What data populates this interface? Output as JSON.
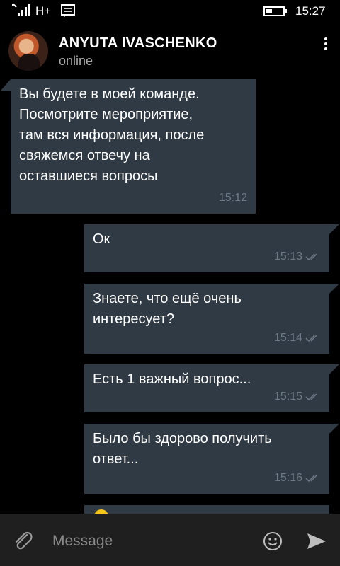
{
  "status_bar": {
    "network": "H+",
    "time": "15:27"
  },
  "header": {
    "name": "ANYUTA IVASCHENKO",
    "status": "online"
  },
  "messages": [
    {
      "dir": "in",
      "text": "Вы будете в моей команде.\nПосмотрите мероприятие,\nтам вся информация, после\nсвяжемся отвечу на\nоставшиеся вопросы",
      "time": "15:12"
    },
    {
      "dir": "out",
      "text": "Ок",
      "time": "15:13"
    },
    {
      "dir": "out",
      "text": "Знаете, что ещё очень\nинтересует?",
      "time": "15:14"
    },
    {
      "dir": "out",
      "text": "Есть 1 важный вопрос...",
      "time": "15:15"
    },
    {
      "dir": "out",
      "text": "Было бы здорово получить\nответ...",
      "time": "15:16"
    }
  ],
  "compose": {
    "placeholder": "Message"
  },
  "colors": {
    "bubble": "#2f3a45",
    "meta": "#6e7a86",
    "compose_bg": "#1f1f1f"
  }
}
